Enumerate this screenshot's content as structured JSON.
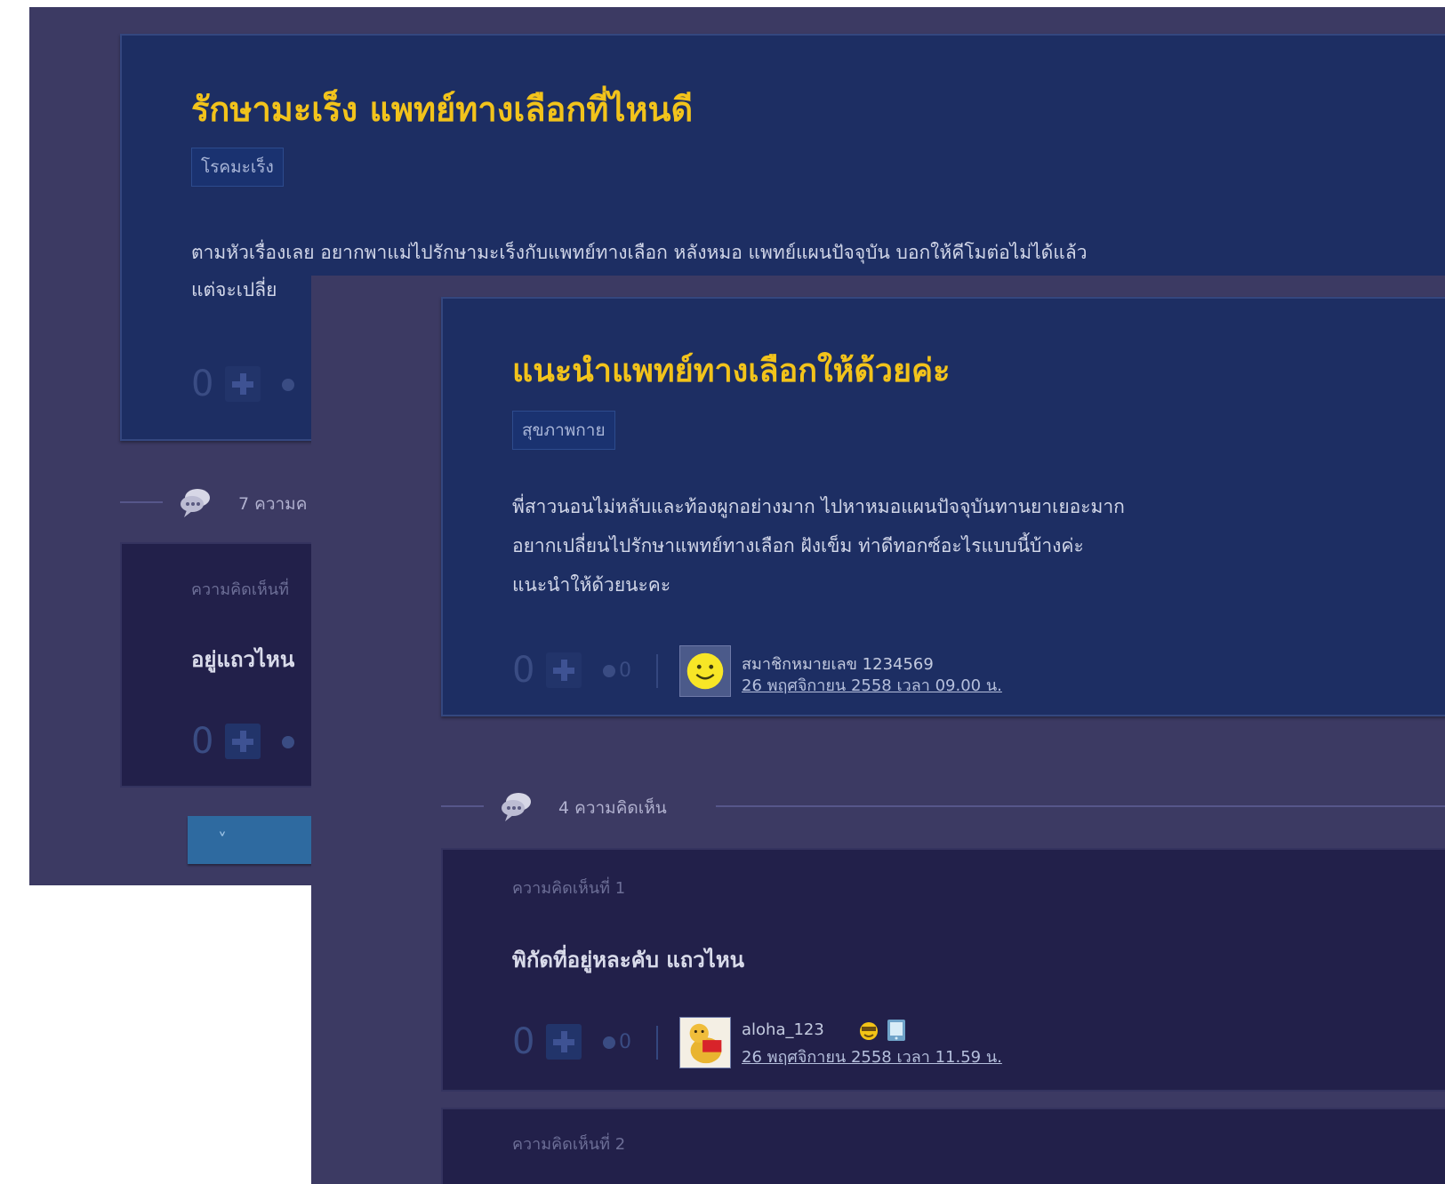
{
  "back_post": {
    "title": "รักษามะเร็ง แพทย์ทางเลือกที่ไหนดี",
    "tag": "โรคมะเร็ง",
    "body_line1": "ตามหัวเรื่องเลย อยากพาแม่ไปรักษามะเร็งกับแพทย์ทางเลือก หลังหมอ แพทย์แผนปัจจุบัน บอกให้คีโมต่อไม่ได้แล้ว",
    "body_line2": "แต่จะเปลี่ย",
    "vote_count": "0",
    "comments_count": "7 ความค",
    "comment1_label": "ความคิดเห็นที่",
    "comment1_text": "อยู่แถวไหน",
    "comment1_vote": "0",
    "expand_label": "˅"
  },
  "front_post": {
    "title": "แนะนำแพทย์ทางเลือกให้ด้วยค่ะ",
    "tag": "สุขภาพกาย",
    "body_lines": [
      "พี่สาวนอนไม่หลับและท้องผูกอย่างมาก ไปหาหมอแผนปัจจุบันทานยาเยอะมาก",
      "อยากเปลี่ยนไปรักษาแพทย์ทางเลือก ฝังเข็ม ท่าดีทอกซ์อะไรแบบนี้บ้างค่ะ",
      "แนะนำให้ด้วยนะคะ"
    ],
    "vote_count": "0",
    "emotion_count": "0",
    "author_name": "สมาชิกหมายเลข 1234569",
    "author_time": "26 พฤศจิกายน 2558 เวลา 09.00 น.",
    "comments_count": "4 ความคิดเห็น",
    "comments": [
      {
        "label": "ความคิดเห็นที่ 1",
        "text": "พิกัดที่อยู่หละคับ แถวไหน",
        "vote_count": "0",
        "emotion_count": "0",
        "author_name": "aloha_123",
        "author_time": "26 พฤศจิกายน 2558 เวลา 11.59 น."
      },
      {
        "label": "ความคิดเห็นที่ 2"
      }
    ]
  },
  "colors": {
    "page_bg": "#3c3a63",
    "topic_bg": "#1d2e63",
    "title": "#f2c31b",
    "comment_bg": "#22204a"
  }
}
